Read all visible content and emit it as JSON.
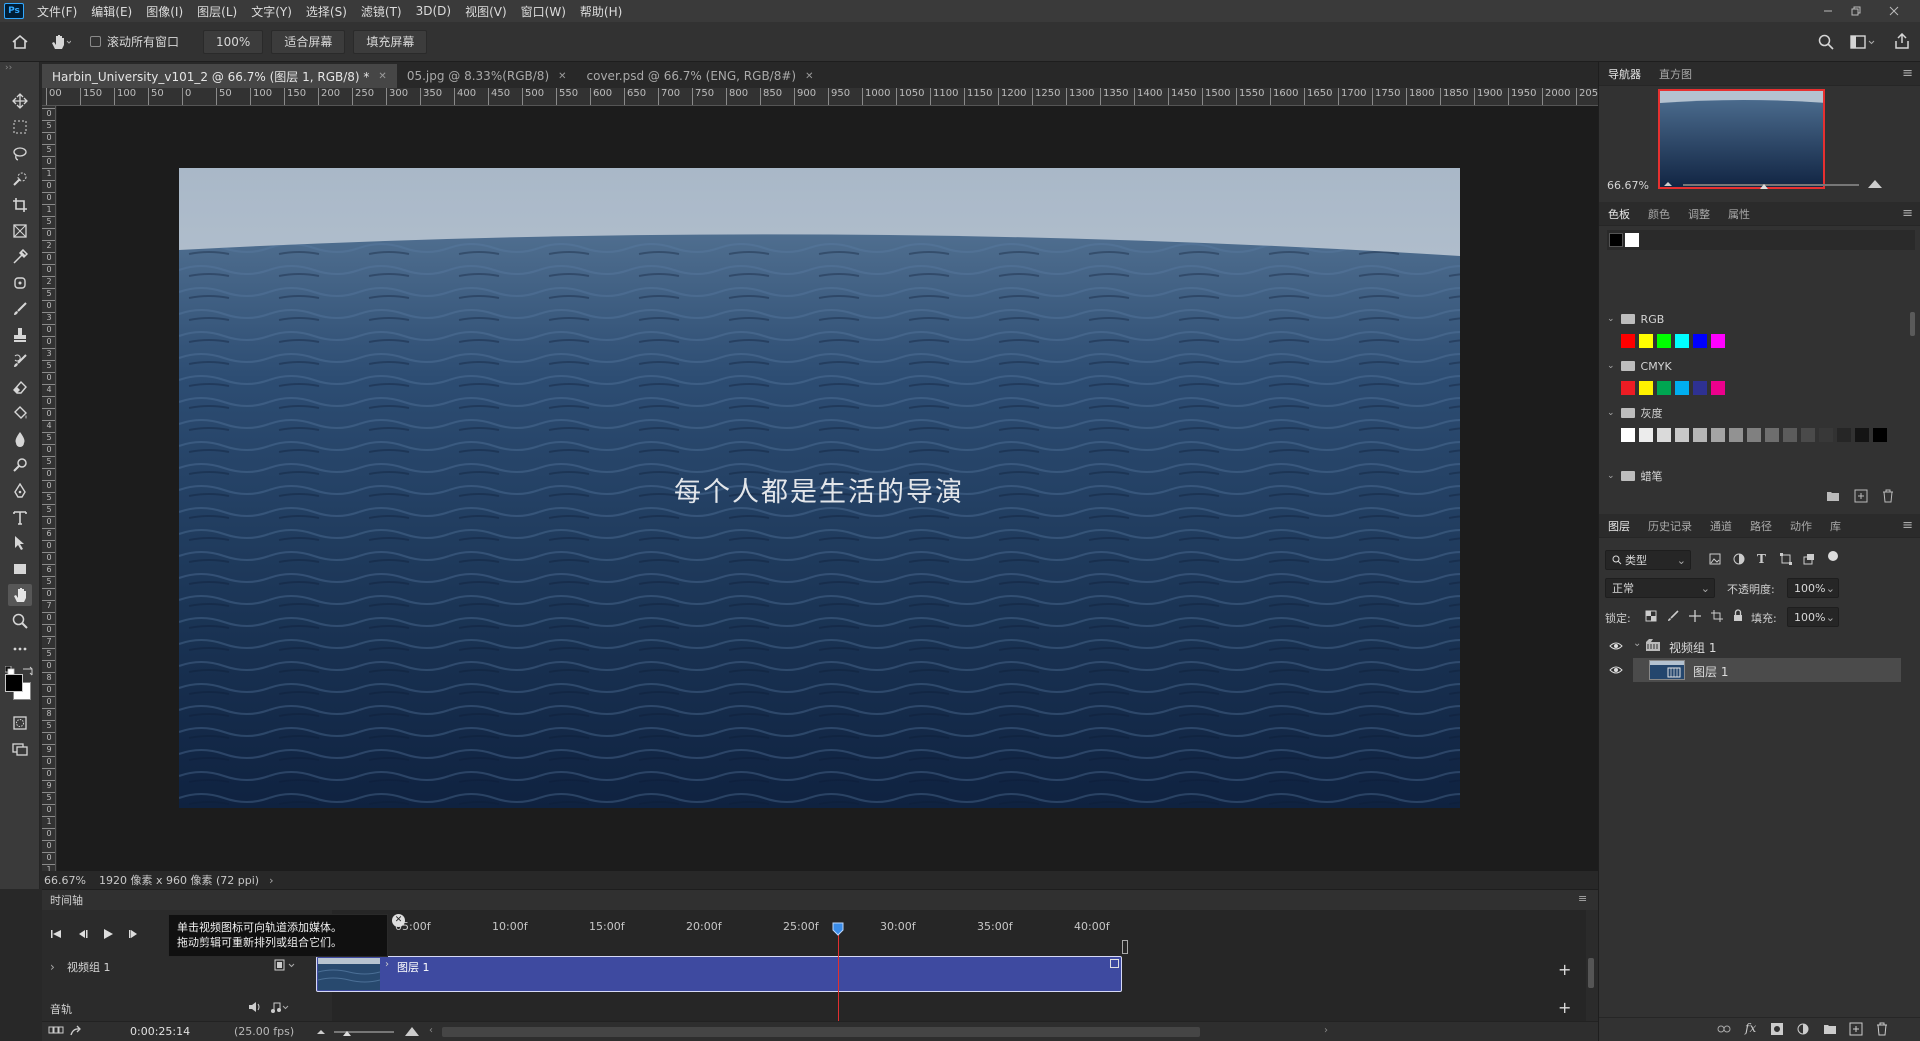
{
  "app": {
    "logo": "Ps"
  },
  "menu": [
    "文件(F)",
    "编辑(E)",
    "图像(I)",
    "图层(L)",
    "文字(Y)",
    "选择(S)",
    "滤镜(T)",
    "3D(D)",
    "视图(V)",
    "窗口(W)",
    "帮助(H)"
  ],
  "options": {
    "scroll_all_label": "滚动所有窗口",
    "zoom_btn": "100%",
    "fit_screen": "适合屏幕",
    "fill_screen": "填充屏幕"
  },
  "tabs": [
    {
      "label": "Harbin_University_v101_2 @ 66.7% (图层 1, RGB/8) *",
      "active": true
    },
    {
      "label": "05.jpg @ 8.33%(RGB/8)",
      "active": false
    },
    {
      "label": "cover.psd @ 66.7% (ENG, RGB/8#)",
      "active": false
    }
  ],
  "ruler_h": [
    "00",
    "150",
    "100",
    "50",
    "0",
    "50",
    "100",
    "150",
    "200",
    "250",
    "300",
    "350",
    "400",
    "450",
    "500",
    "550",
    "600",
    "650",
    "700",
    "750",
    "800",
    "850",
    "900",
    "950",
    "1000",
    "1050",
    "1100",
    "1150",
    "1200",
    "1250",
    "1300",
    "1350",
    "1400",
    "1450",
    "1500",
    "1550",
    "1600",
    "1650",
    "1700",
    "1750",
    "1800",
    "1850",
    "1900",
    "1950",
    "2000",
    "2050"
  ],
  "ruler_v": [
    "0",
    "5",
    "0",
    "5",
    "0",
    "1",
    "0",
    "0",
    "1",
    "5",
    "0",
    "2",
    "0",
    "0",
    "2",
    "5",
    "0",
    "3",
    "0",
    "0",
    "3",
    "5",
    "0",
    "4",
    "0",
    "0",
    "4",
    "5",
    "0",
    "5",
    "0",
    "0",
    "5",
    "5",
    "0",
    "6",
    "0",
    "0",
    "6",
    "5",
    "0",
    "7",
    "0",
    "0",
    "7",
    "5",
    "0",
    "8",
    "0",
    "0",
    "8",
    "5",
    "0",
    "9",
    "0",
    "0",
    "9",
    "5",
    "0",
    "1",
    "0",
    "0",
    "0",
    "1"
  ],
  "canvas": {
    "subtitle": "每个人都是生活的导演"
  },
  "status": {
    "zoom": "66.67%",
    "doc_info": "1920 像素 x 960 像素 (72 ppi)"
  },
  "timeline": {
    "title": "时间轴",
    "ticks": [
      "05:00f",
      "10:00f",
      "15:00f",
      "20:00f",
      "25:00f",
      "30:00f",
      "35:00f",
      "40:00f"
    ],
    "tooltip_line1": "单击视频图标可向轨道添加媒体。",
    "tooltip_line2": "拖动剪辑可重新排列或组合它们。",
    "track_group": "视频组 1",
    "clip_label": "图层 1",
    "audio_label": "音轨",
    "timecode": "0:00:25:14",
    "fps": "(25.00 fps)",
    "playhead_fraction": 0.64
  },
  "navigator": {
    "tabs": [
      "导航器",
      "直方图"
    ],
    "zoom": "66.67%",
    "zoom_fraction": 0.46
  },
  "swatches": {
    "tabs": [
      "色板",
      "颜色",
      "调整",
      "属性"
    ],
    "groups": {
      "rgb": "RGB",
      "cmyk": "CMYK",
      "gray": "灰度",
      "pastel": "蜡笔"
    },
    "rgb_colors": [
      "#ff0000",
      "#ffff00",
      "#00ff00",
      "#00ffff",
      "#0000ff",
      "#ff00ff"
    ],
    "cmyk_colors": [
      "#ed1c24",
      "#fff200",
      "#00a651",
      "#00aeef",
      "#2e3192",
      "#ec008c"
    ],
    "gray_colors": [
      "#ffffff",
      "#ececec",
      "#dadada",
      "#c8c8c8",
      "#b6b6b6",
      "#a4a4a4",
      "#929292",
      "#808080",
      "#6e6e6e",
      "#5c5c5c",
      "#4a4a4a",
      "#383838",
      "#262626",
      "#141414",
      "#000000"
    ]
  },
  "layers": {
    "tabs": [
      "图层",
      "历史记录",
      "通道",
      "路径",
      "动作",
      "库"
    ],
    "filter": "类型",
    "blend": "正常",
    "opacity_label": "不透明度:",
    "opacity": "100%",
    "lock_label": "锁定:",
    "fill_label": "填充:",
    "fill": "100%",
    "items": [
      {
        "name": "视频组 1"
      },
      {
        "name": "图层 1"
      }
    ]
  }
}
